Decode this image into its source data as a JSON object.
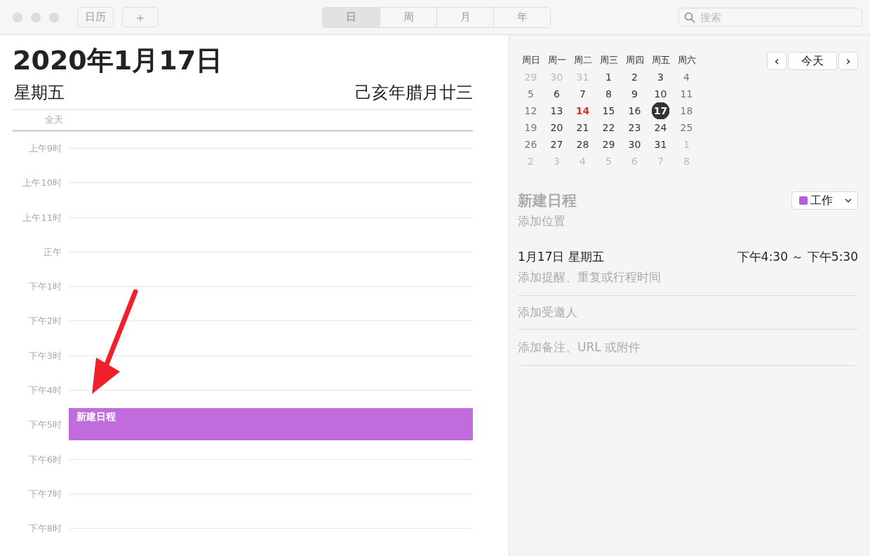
{
  "toolbar": {
    "calendars_button": "日历",
    "add_button": "＋",
    "view_tabs": [
      {
        "label": "日",
        "selected": true
      },
      {
        "label": "周",
        "selected": false
      },
      {
        "label": "月",
        "selected": false
      },
      {
        "label": "年",
        "selected": false
      }
    ],
    "search": {
      "placeholder": "搜索"
    }
  },
  "day_view": {
    "date_title": "2020年1月17日",
    "weekday": "星期五",
    "lunar_date": "己亥年腊月廿三",
    "all_day_label": "全天",
    "hours": [
      {
        "label": "上午9时"
      },
      {
        "label": "上午10时"
      },
      {
        "label": "上午11时"
      },
      {
        "label": "正午"
      },
      {
        "label": "下午1时"
      },
      {
        "label": "下午2时"
      },
      {
        "label": "下午3时"
      },
      {
        "label": "下午4时",
        "events": [
          {
            "title": "新建日程",
            "color": "#c06cdc"
          }
        ]
      },
      {
        "label": "下午5时"
      },
      {
        "label": "下午6时"
      },
      {
        "label": "下午7时"
      },
      {
        "label": "下午8时"
      }
    ]
  },
  "mini_calendar": {
    "weekdays": [
      "周日",
      "周一",
      "周二",
      "周三",
      "周四",
      "周五",
      "周六"
    ],
    "prev_button": "‹",
    "today_button": "今天",
    "next_button": "›",
    "weeks": [
      [
        {
          "day": "29",
          "muted": true,
          "today": false,
          "selected": false
        },
        {
          "day": "30",
          "muted": true,
          "today": false,
          "selected": false
        },
        {
          "day": "31",
          "muted": true,
          "today": false,
          "selected": false
        },
        {
          "day": "1",
          "muted": false,
          "today": false,
          "selected": false
        },
        {
          "day": "2",
          "muted": false,
          "today": false,
          "selected": false
        },
        {
          "day": "3",
          "muted": false,
          "today": false,
          "selected": false
        },
        {
          "day": "4",
          "muted": false,
          "today": false,
          "selected": false
        }
      ],
      [
        {
          "day": "5",
          "muted": false,
          "today": false,
          "selected": false
        },
        {
          "day": "6",
          "muted": false,
          "today": false,
          "selected": false
        },
        {
          "day": "7",
          "muted": false,
          "today": false,
          "selected": false
        },
        {
          "day": "8",
          "muted": false,
          "today": false,
          "selected": false
        },
        {
          "day": "9",
          "muted": false,
          "today": false,
          "selected": false
        },
        {
          "day": "10",
          "muted": false,
          "today": false,
          "selected": false
        },
        {
          "day": "11",
          "muted": false,
          "today": false,
          "selected": false
        }
      ],
      [
        {
          "day": "12",
          "muted": false,
          "today": false,
          "selected": false
        },
        {
          "day": "13",
          "muted": false,
          "today": false,
          "selected": false
        },
        {
          "day": "14",
          "muted": false,
          "today": true,
          "selected": false
        },
        {
          "day": "15",
          "muted": false,
          "today": false,
          "selected": false
        },
        {
          "day": "16",
          "muted": false,
          "today": false,
          "selected": false
        },
        {
          "day": "17",
          "muted": false,
          "today": false,
          "selected": true
        },
        {
          "day": "18",
          "muted": false,
          "today": false,
          "selected": false
        }
      ],
      [
        {
          "day": "19",
          "muted": false,
          "today": false,
          "selected": false
        },
        {
          "day": "20",
          "muted": false,
          "today": false,
          "selected": false
        },
        {
          "day": "21",
          "muted": false,
          "today": false,
          "selected": false
        },
        {
          "day": "22",
          "muted": false,
          "today": false,
          "selected": false
        },
        {
          "day": "23",
          "muted": false,
          "today": false,
          "selected": false
        },
        {
          "day": "24",
          "muted": false,
          "today": false,
          "selected": false
        },
        {
          "day": "25",
          "muted": false,
          "today": false,
          "selected": false
        }
      ],
      [
        {
          "day": "26",
          "muted": false,
          "today": false,
          "selected": false
        },
        {
          "day": "27",
          "muted": false,
          "today": false,
          "selected": false
        },
        {
          "day": "28",
          "muted": false,
          "today": false,
          "selected": false
        },
        {
          "day": "29",
          "muted": false,
          "today": false,
          "selected": false
        },
        {
          "day": "30",
          "muted": false,
          "today": false,
          "selected": false
        },
        {
          "day": "31",
          "muted": false,
          "today": false,
          "selected": false
        },
        {
          "day": "1",
          "muted": true,
          "today": false,
          "selected": false
        }
      ],
      [
        {
          "day": "2",
          "muted": true,
          "today": false,
          "selected": false
        },
        {
          "day": "3",
          "muted": true,
          "today": false,
          "selected": false
        },
        {
          "day": "4",
          "muted": true,
          "today": false,
          "selected": false
        },
        {
          "day": "5",
          "muted": true,
          "today": false,
          "selected": false
        },
        {
          "day": "6",
          "muted": true,
          "today": false,
          "selected": false
        },
        {
          "day": "7",
          "muted": true,
          "today": false,
          "selected": false
        },
        {
          "day": "8",
          "muted": true,
          "today": false,
          "selected": false
        }
      ]
    ]
  },
  "event_detail": {
    "title": "新建日程",
    "calendar": {
      "label": "工作",
      "color": "#b55fd6"
    },
    "location_placeholder": "添加位置",
    "date": "1月17日 星期五",
    "time_range": "下午4:30 ～ 下午5:30",
    "alert_placeholder": "添加提醒、重复或行程时间",
    "invitees_placeholder": "添加受邀人",
    "notes_placeholder": "添加备注、URL 或附件"
  }
}
